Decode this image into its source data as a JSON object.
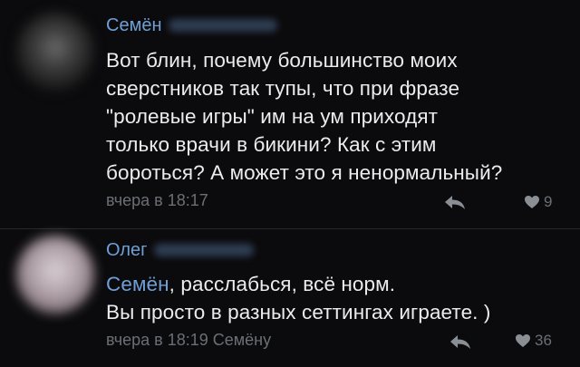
{
  "comments": [
    {
      "author": "Семён",
      "text": "Вот блин, почему большинство моих\nсверстников так тупы, что при фразе\n\"ролевые игры\" им на ум приходят\nтолько врачи в бикини? Как с этим\nбороться? А может это я ненормальный?",
      "time": "вчера в 18:17",
      "likes": "9",
      "icons": {
        "reply": "reply-arrow-icon",
        "like": "heart-icon"
      }
    },
    {
      "author": "Олег",
      "reply_to": "Семён",
      "text": ", расслабься, всё норм.\nВы просто в разных сеттингах играете. )",
      "time": "вчера в 18:19 Семёну",
      "likes": "36",
      "icons": {
        "reply": "reply-arrow-icon",
        "like": "heart-icon"
      }
    }
  ],
  "colors": {
    "background": "#0b0b0d",
    "author": "#6f9fd6",
    "text": "#ececec",
    "meta": "#6b6f75"
  }
}
